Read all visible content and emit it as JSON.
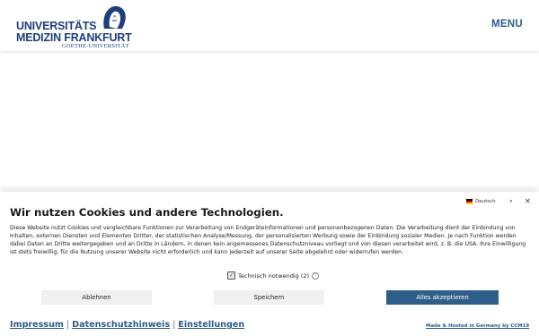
{
  "header": {
    "logo": {
      "line1": "UNIVERSITÄTS",
      "line2": "MEDIZIN FRANKFURT",
      "line3": "GOETHE-UNIVERSITÄT"
    },
    "menu_label": "MENU"
  },
  "cookie_banner": {
    "language": "Deutsch",
    "close_symbol": "✕",
    "title": "Wir nutzen Cookies und andere Technologien.",
    "text": "Diese Website nutzt Cookies und vergleichbare Funktionen zur Verarbeitung von Endgeräteinformationen und personenbezogenen Daten. Die Verarbeitung dient der Einbindung von Inhalten, externen Diensten und Elementen Dritter, der statistischen Analyse/Messung, der personalisierten Werbung sowie der Einbindung sozialer Medien. Je nach Funktion werden dabei Daten an Dritte weitergegeben und an Dritte in Ländern, in denen kein angemessenes Datenschutzniveau vorliegt und von diesen verarbeitet wird, z. B. die USA. Ihre Einwilligung ist stets freiwillig, für die Nutzung unserer Website nicht erforderlich und kann jederzeit auf unserer Seite abgelehnt oder widerrufen werden.",
    "checkbox_label": "Technisch notwendig (2)",
    "buttons": {
      "reject": "Ablehnen",
      "save": "Speichern",
      "accept_all": "Alles akzeptieren"
    },
    "links": [
      "Impressum",
      "Datenschutzhinweis",
      "Einstellungen"
    ],
    "hosted_by": "Made & Hosted in Germany by CCM19"
  },
  "colors": {
    "brand_blue": "#1e3f7a",
    "link_blue": "#2a5c86",
    "accept_button": "#2d5f8a"
  }
}
